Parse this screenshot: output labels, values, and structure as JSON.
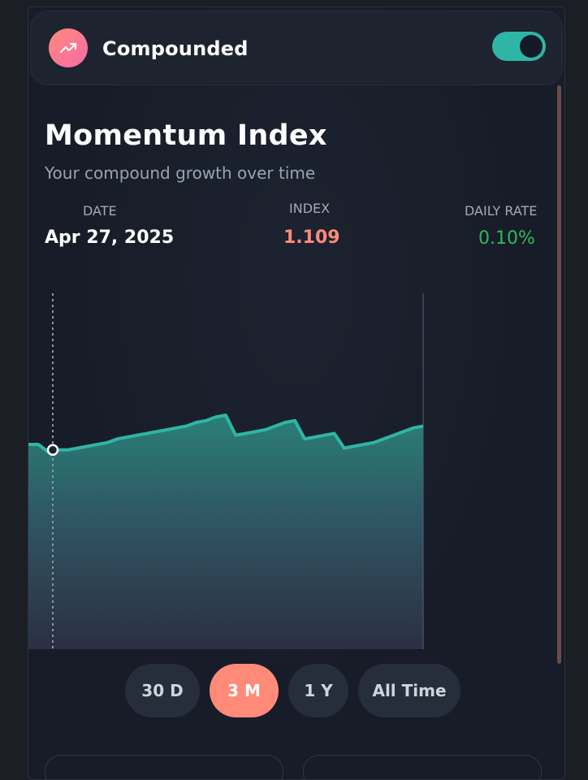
{
  "header": {
    "title": "Compounded",
    "logo_icon": "trending-up-icon",
    "toggle_on": true
  },
  "main": {
    "title": "Momentum Index",
    "subtitle": "Your compound growth over time"
  },
  "stats": {
    "date": {
      "label": "DATE",
      "value": "Apr 27, 2025"
    },
    "index": {
      "label": "INDEX",
      "value": "1.109"
    },
    "daily_rate": {
      "label": "DAILY RATE",
      "value": "0.10%"
    }
  },
  "colors": {
    "accent": "#2fb5a5",
    "index_value": "#ff8a78",
    "rate_value": "#2fb85a",
    "active_range": "#ff8a78"
  },
  "ranges": [
    {
      "label": "30 D",
      "active": false
    },
    {
      "label": "3 M",
      "active": true
    },
    {
      "label": "1 Y",
      "active": false
    },
    {
      "label": "All Time",
      "active": false
    }
  ],
  "chart_data": {
    "type": "area",
    "series": [
      {
        "values": [
          1.112,
          1.112,
          1.108,
          1.109,
          1.109,
          1.11,
          1.111,
          1.112,
          1.113,
          1.115,
          1.116,
          1.117,
          1.118,
          1.119,
          1.12,
          1.121,
          1.122,
          1.124,
          1.125,
          1.127,
          1.128,
          1.117,
          1.118,
          1.119,
          1.12,
          1.122,
          1.124,
          1.125,
          1.115,
          1.116,
          1.117,
          1.118,
          1.11,
          1.111,
          1.112,
          1.113,
          1.115,
          1.117,
          1.119,
          1.121,
          1.122
        ]
      }
    ],
    "ylim": [
      1.0,
      1.2
    ],
    "selected_index": 3,
    "grid": false
  }
}
